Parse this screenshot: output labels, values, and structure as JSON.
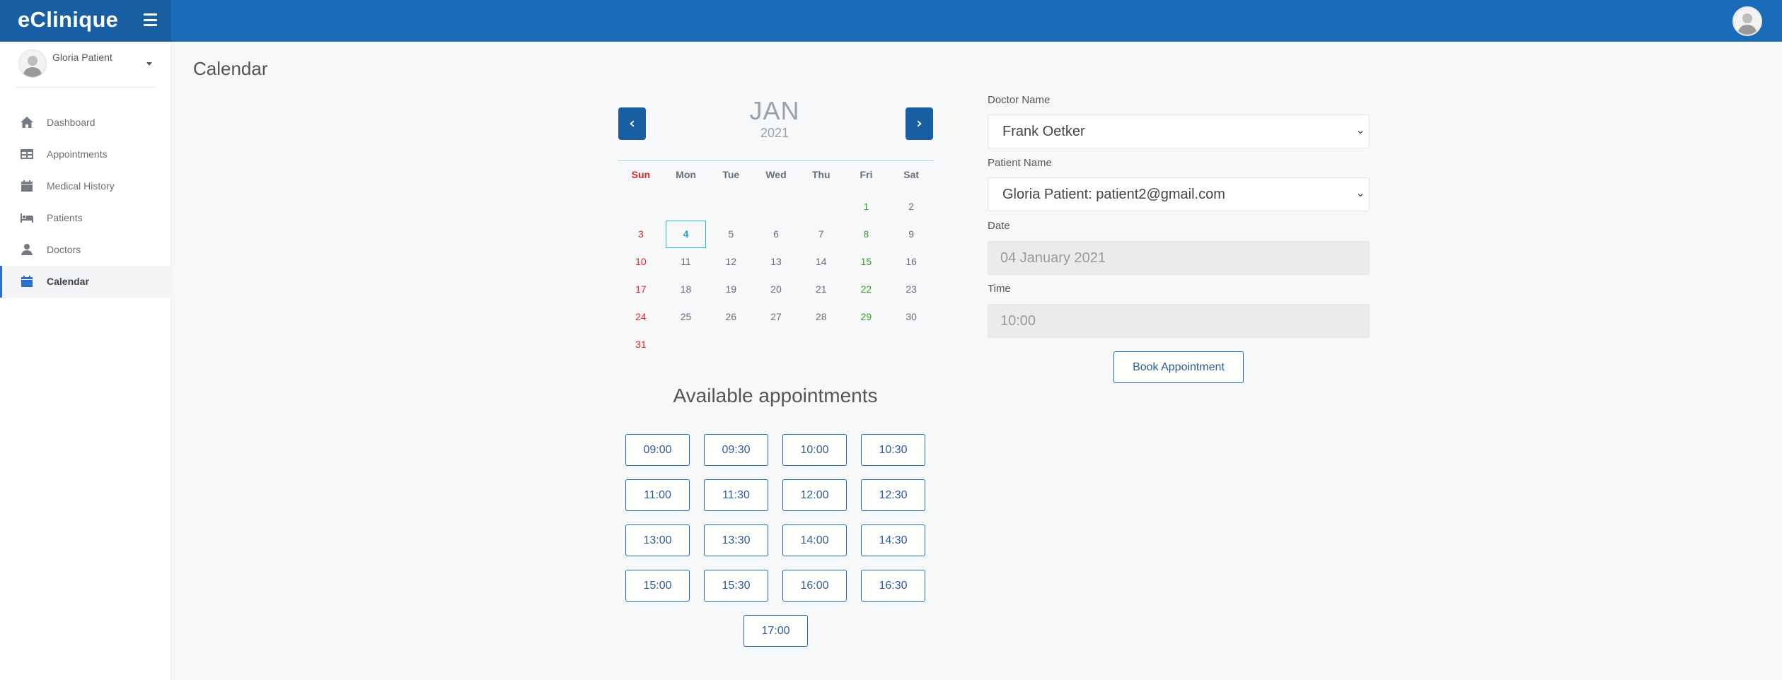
{
  "app": {
    "title": "eClinique"
  },
  "user": {
    "name": "Gloria Patient"
  },
  "sidebar": {
    "items": [
      {
        "label": "Dashboard",
        "icon": "home-icon"
      },
      {
        "label": "Appointments",
        "icon": "table-icon"
      },
      {
        "label": "Medical History",
        "icon": "calendar-icon"
      },
      {
        "label": "Patients",
        "icon": "bed-icon"
      },
      {
        "label": "Doctors",
        "icon": "user-md-icon"
      },
      {
        "label": "Calendar",
        "icon": "calendar-icon",
        "active": true
      }
    ]
  },
  "page": {
    "title": "Calendar"
  },
  "calendar": {
    "prev_label": "‹",
    "next_label": "›",
    "month": "JAN",
    "year": "2021",
    "weekdays": [
      "Sun",
      "Mon",
      "Tue",
      "Wed",
      "Thu",
      "Fri",
      "Sat"
    ],
    "leading_blanks": 5,
    "days": [
      "1",
      "2",
      "3",
      "4",
      "5",
      "6",
      "7",
      "8",
      "9",
      "10",
      "11",
      "12",
      "13",
      "14",
      "15",
      "16",
      "17",
      "18",
      "19",
      "20",
      "21",
      "22",
      "23",
      "24",
      "25",
      "26",
      "27",
      "28",
      "29",
      "30",
      "31"
    ],
    "selected_day": "4"
  },
  "availability": {
    "title": "Available appointments",
    "slots": [
      "09:00",
      "09:30",
      "10:00",
      "10:30",
      "11:00",
      "11:30",
      "12:00",
      "12:30",
      "13:00",
      "13:30",
      "14:00",
      "14:30",
      "15:00",
      "15:30",
      "16:00",
      "16:30",
      "17:00"
    ]
  },
  "form": {
    "doctor_label": "Doctor Name",
    "doctor_value": "Frank Oetker",
    "patient_label": "Patient Name",
    "patient_value": "Gloria Patient: patient2@gmail.com",
    "date_label": "Date",
    "date_value": "04 January 2021",
    "time_label": "Time",
    "time_value": "10:00",
    "book_label": "Book Appointment"
  },
  "colors": {
    "topbar": "#1a6bb8",
    "brand": "#175ea3",
    "sunday": "#e0262a",
    "friday": "#3a9a2a",
    "selected": "#1aa6c2"
  }
}
